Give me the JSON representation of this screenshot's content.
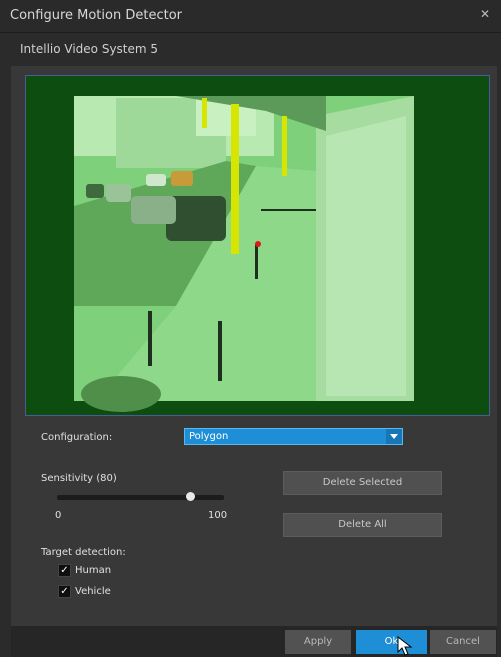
{
  "window": {
    "title": "Configure Motion Detector",
    "close_glyph": "✕",
    "subtitle": "Intellio Video System 5"
  },
  "config": {
    "label": "Configuration:",
    "selected": "Polygon"
  },
  "sensitivity": {
    "label": "Sensitivity (80)",
    "min_label": "0",
    "max_label": "100",
    "value": 80
  },
  "buttons": {
    "delete_selected": "Delete Selected",
    "delete_all": "Delete All"
  },
  "target": {
    "label": "Target detection:",
    "check_glyph": "✓",
    "human": "Human",
    "vehicle": "Vehicle"
  },
  "footer": {
    "apply": "Apply",
    "ok": "Ok",
    "cancel": "Cancel"
  },
  "colors": {
    "accent": "#1e8fd6",
    "mask_green": "#0d4d10",
    "mask_overlay": "#55c84a"
  }
}
